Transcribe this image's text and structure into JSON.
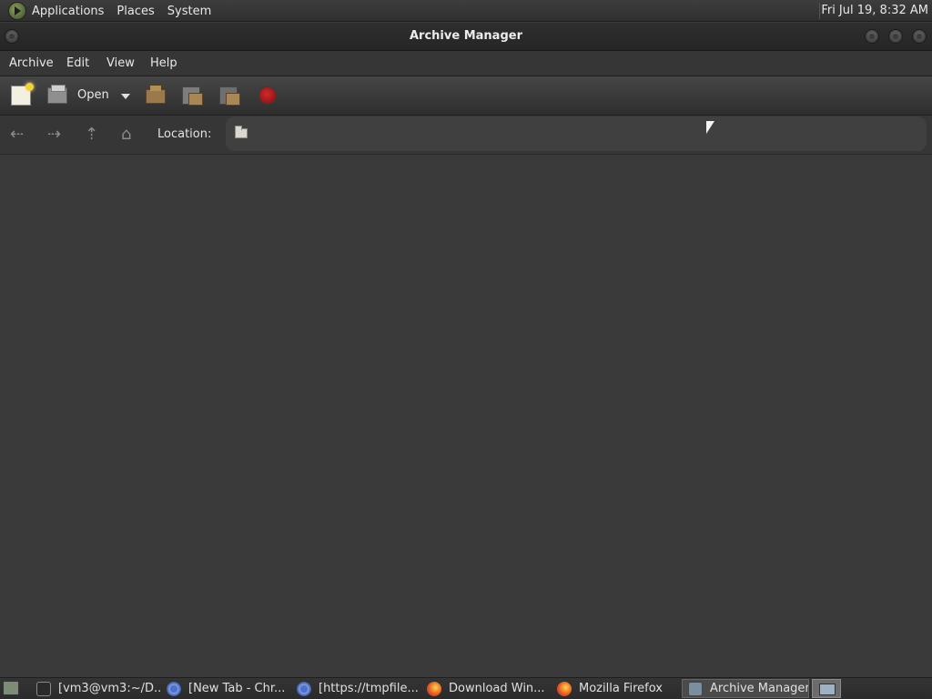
{
  "top_panel": {
    "menus": [
      "Applications",
      "Places",
      "System"
    ],
    "clock": "Fri Jul 19,  8:32 AM"
  },
  "window": {
    "title": "Archive Manager",
    "menubar": [
      "Archive",
      "Edit",
      "View",
      "Help"
    ],
    "toolbar": {
      "open_label": "Open"
    },
    "location": {
      "label": "Location:",
      "value": ""
    }
  },
  "taskbar": {
    "tasks": [
      {
        "label": "[vm3@vm3:~/D...",
        "icon": "terminal-icon"
      },
      {
        "label": "[New Tab - Chr...",
        "icon": "chrome-icon"
      },
      {
        "label": "[https://tmpfile...",
        "icon": "chrome-icon"
      },
      {
        "label": "Download Win...",
        "icon": "firefox-icon"
      },
      {
        "label": "Mozilla Firefox",
        "icon": "firefox-icon"
      },
      {
        "label": "Archive Manager",
        "icon": "archive-manager-icon",
        "active": true
      }
    ]
  }
}
